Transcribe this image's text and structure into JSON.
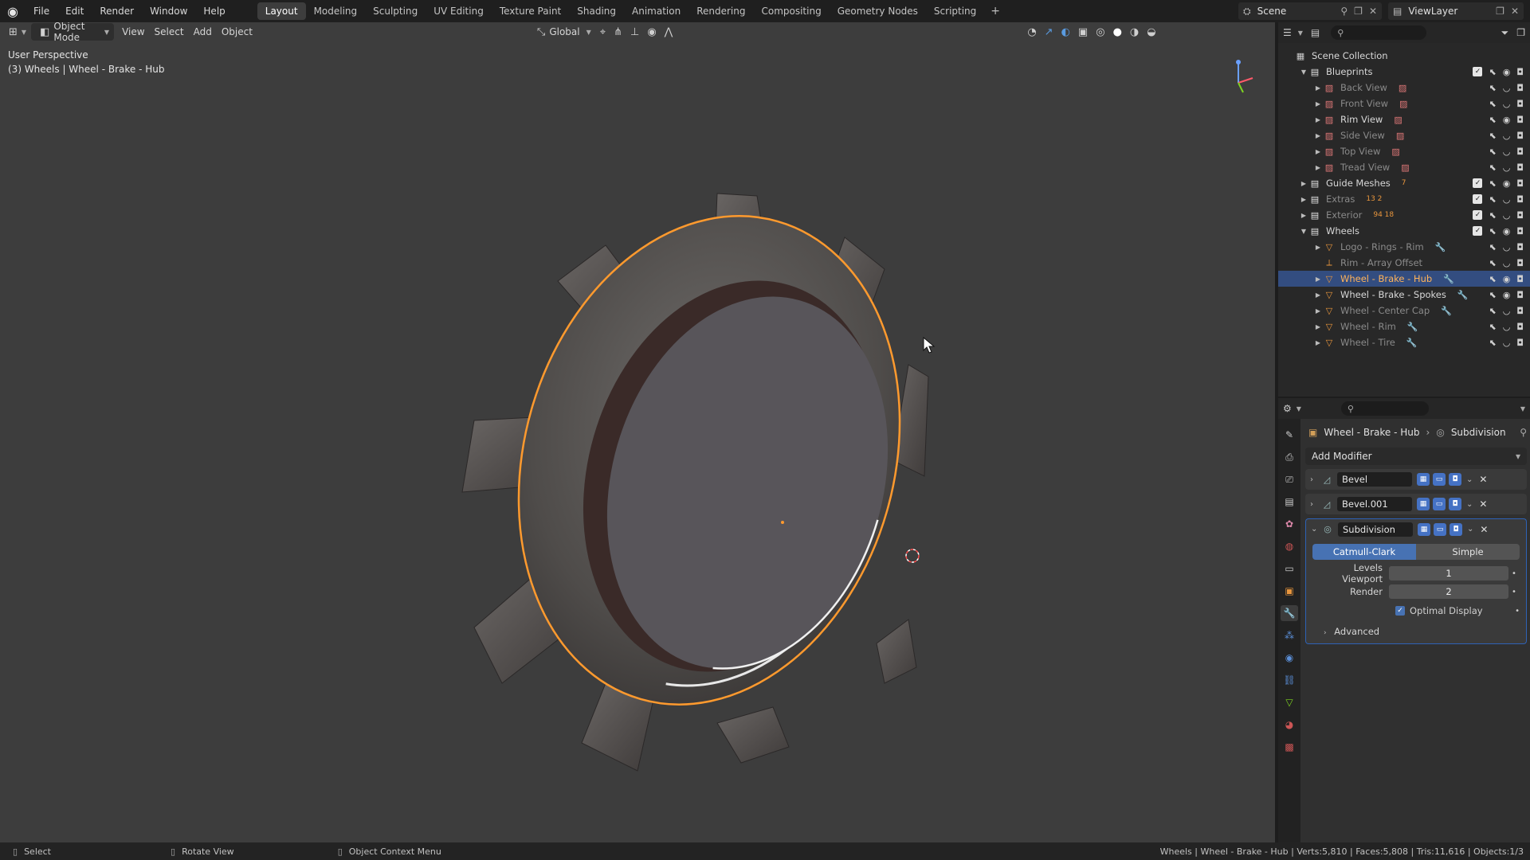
{
  "menu": [
    "File",
    "Edit",
    "Render",
    "Window",
    "Help"
  ],
  "workspaces": [
    {
      "label": "Layout",
      "active": true
    },
    {
      "label": "Modeling"
    },
    {
      "label": "Sculpting"
    },
    {
      "label": "UV Editing"
    },
    {
      "label": "Texture Paint"
    },
    {
      "label": "Shading"
    },
    {
      "label": "Animation"
    },
    {
      "label": "Rendering"
    },
    {
      "label": "Compositing"
    },
    {
      "label": "Geometry Nodes"
    },
    {
      "label": "Scripting"
    }
  ],
  "scene": {
    "label": "Scene"
  },
  "view_layer": {
    "label": "ViewLayer"
  },
  "viewport_header": {
    "mode": "Object Mode",
    "menus": [
      "View",
      "Select",
      "Add",
      "Object"
    ],
    "transform": "Global"
  },
  "viewport_overlay": {
    "perspective": "User Perspective",
    "object_info": "(3) Wheels | Wheel - Brake - Hub"
  },
  "outliner": {
    "rows": [
      {
        "label": "Scene Collection",
        "depth": 0,
        "type": "scene",
        "arrow": ""
      },
      {
        "label": "Blueprints",
        "depth": 1,
        "type": "collection",
        "arrow": "▼",
        "check": true
      },
      {
        "label": "Back View",
        "depth": 2,
        "type": "image",
        "dim": true,
        "arrow": "▶"
      },
      {
        "label": "Front View",
        "depth": 2,
        "type": "image",
        "dim": true,
        "arrow": "▶"
      },
      {
        "label": "Rim View",
        "depth": 2,
        "type": "image",
        "arrow": "▶"
      },
      {
        "label": "Side View",
        "depth": 2,
        "type": "image",
        "dim": true,
        "arrow": "▶"
      },
      {
        "label": "Top View",
        "depth": 2,
        "type": "image",
        "dim": true,
        "arrow": "▶"
      },
      {
        "label": "Tread View",
        "depth": 2,
        "type": "image",
        "dim": true,
        "arrow": "▶"
      },
      {
        "label": "Guide Meshes",
        "depth": 1,
        "type": "collection",
        "arrow": "▶",
        "check": true,
        "extra": "7"
      },
      {
        "label": "Extras",
        "depth": 1,
        "type": "collection",
        "dim": true,
        "arrow": "▶",
        "check": true,
        "extra": "13 2"
      },
      {
        "label": "Exterior",
        "depth": 1,
        "type": "collection",
        "dim": true,
        "arrow": "▶",
        "check": true,
        "extra": "94 18"
      },
      {
        "label": "Wheels",
        "depth": 1,
        "type": "collection",
        "arrow": "▼",
        "check": true
      },
      {
        "label": "Logo - Rings - Rim",
        "depth": 2,
        "type": "mesh",
        "dim": true,
        "arrow": "▶"
      },
      {
        "label": "Rim - Array Offset",
        "depth": 2,
        "type": "empty",
        "dim": true,
        "arrow": ""
      },
      {
        "label": "Wheel - Brake - Hub",
        "depth": 2,
        "type": "mesh",
        "selected": true,
        "arrow": "▶"
      },
      {
        "label": "Wheel - Brake - Spokes",
        "depth": 2,
        "type": "mesh",
        "arrow": "▶"
      },
      {
        "label": "Wheel - Center Cap",
        "depth": 2,
        "type": "mesh",
        "dim": true,
        "arrow": "▶"
      },
      {
        "label": "Wheel - Rim",
        "depth": 2,
        "type": "mesh",
        "dim": true,
        "arrow": "▶"
      },
      {
        "label": "Wheel - Tire",
        "depth": 2,
        "type": "mesh",
        "dim": true,
        "arrow": "▶"
      }
    ]
  },
  "properties": {
    "breadcrumb": {
      "object": "Wheel - Brake - Hub",
      "modifier": "Subdivision"
    },
    "add_modifier": "Add Modifier",
    "modifiers": [
      {
        "name": "Bevel",
        "open": false
      },
      {
        "name": "Bevel.001",
        "open": false
      },
      {
        "name": "Subdivision",
        "open": true
      }
    ],
    "subdivision": {
      "methods": [
        "Catmull-Clark",
        "Simple"
      ],
      "active_method": "Catmull-Clark",
      "levels_viewport_label": "Levels Viewport",
      "levels_viewport": "1",
      "render_label": "Render",
      "render": "2",
      "optimal_display": "Optimal Display",
      "advanced": "Advanced"
    }
  },
  "statusbar": {
    "select": "Select",
    "rotate": "Rotate View",
    "context": "Object Context Menu",
    "stats": "Wheels | Wheel - Brake - Hub | Verts:5,810 | Faces:5,808 | Tris:11,616 | Objects:1/3"
  },
  "colors": {
    "selection_outline": "#ff9a2e",
    "accent_blue": "#4772b3",
    "viewport_bg": "#3d3d3d"
  }
}
